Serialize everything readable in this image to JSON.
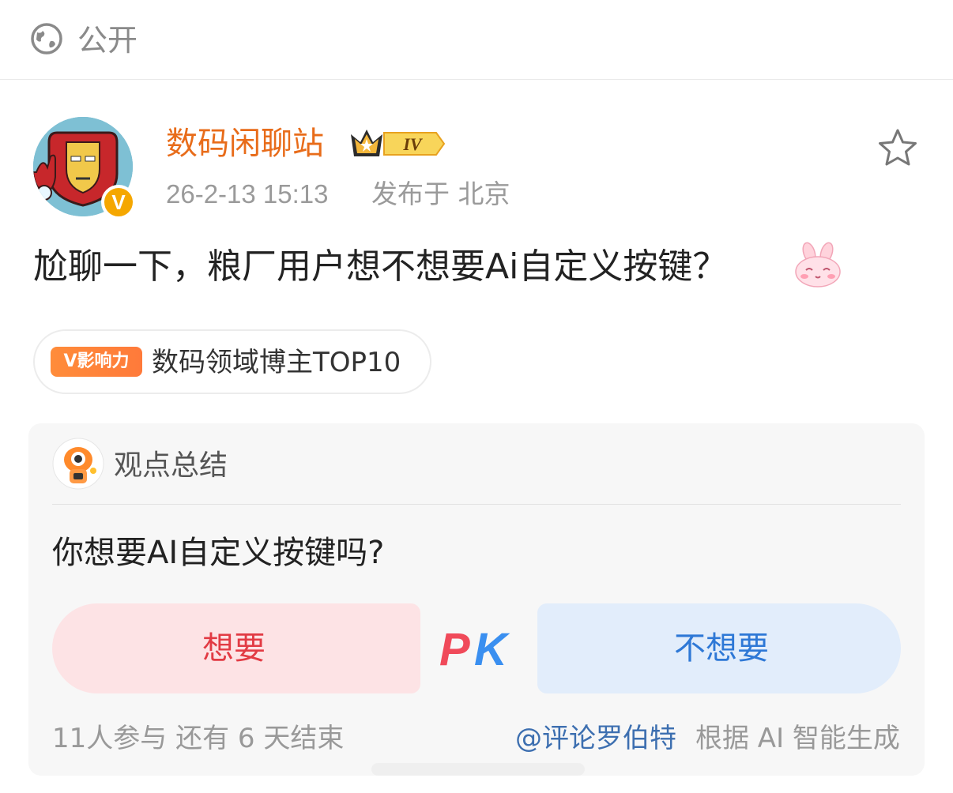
{
  "visibility": {
    "label": "公开",
    "icon": "globe-icon"
  },
  "author": {
    "name": "数码闲聊站",
    "level_badge": "IV",
    "verified_badge": "V",
    "timestamp": "26-2-13 15:13",
    "location": "发布于 北京",
    "name_color": "#e86c1a"
  },
  "actions": {
    "favorite_icon": "star-outline-icon"
  },
  "post": {
    "text": "尬聊一下，粮厂用户想不想要Ai自定义按键？",
    "emoji": "bunny-emoji"
  },
  "influence_tag": {
    "badge": "V影响力",
    "label": "数码领域博主TOP10"
  },
  "opinion_card": {
    "title": "观点总结",
    "question": "你想要AI自定义按键吗?",
    "option_a": "想要",
    "pk_label": "PK",
    "option_b": "不想要",
    "participants": "11人参与  还有 6 天结束",
    "mention": "@评论罗伯特",
    "ai_note": "根据 AI 智能生成",
    "option_a_color": "#e23b44",
    "option_b_color": "#2e78d6"
  }
}
